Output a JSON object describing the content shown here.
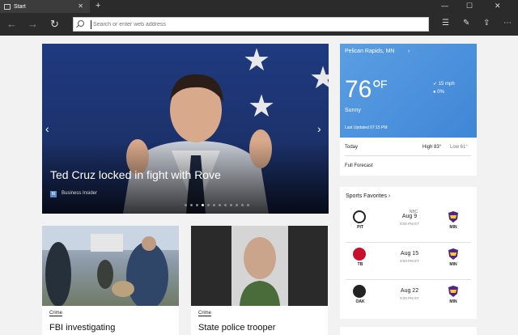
{
  "tabs": [
    {
      "label": "Start"
    }
  ],
  "toolbar": {
    "address_placeholder": "Search or enter web address"
  },
  "hero": {
    "headline": "Ted Cruz locked in fight with Rove",
    "source": "Business Insider",
    "source_logo": "BI",
    "slide_count": 12,
    "active_slide": 3
  },
  "weather": {
    "location": "Pelican Rapids, MN",
    "temperature": "76°",
    "unit": "F",
    "condition": "Sunny",
    "wind": "15 mph",
    "precip": "0%",
    "last_updated": "Last Updated 07:15 PM",
    "today_label": "Today",
    "high": "High 83°",
    "low": "Low 61°",
    "full_forecast": "Full Forecast"
  },
  "sports": {
    "title": "Sports Favorites",
    "games": [
      {
        "home": "PIT",
        "away": "MIN",
        "network": "NBC",
        "date": "Aug 9",
        "time": "8:00 PM ET",
        "home_color": "#fbb917"
      },
      {
        "home": "TB",
        "away": "MIN",
        "network": "",
        "date": "Aug 15",
        "time": "8:00 PM ET",
        "home_color": "#c8102e"
      },
      {
        "home": "OAK",
        "away": "MIN",
        "network": "",
        "date": "Aug 22",
        "time": "8:00 PM ET",
        "home_color": "#222222"
      }
    ]
  },
  "cards": [
    {
      "category": "Crime",
      "title": "FBI investigating"
    },
    {
      "category": "Crime",
      "title": "State police trooper"
    }
  ]
}
